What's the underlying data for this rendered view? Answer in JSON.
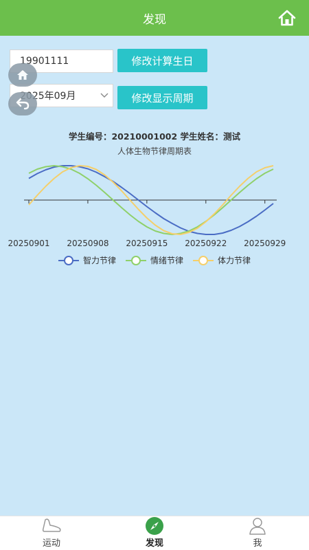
{
  "header": {
    "title": "发现",
    "home_icon": "home-icon"
  },
  "form": {
    "birthday_value": "19901111",
    "month_value": "2025年09月",
    "change_birthday_label": "修改计算生日",
    "change_period_label": "修改显示周期"
  },
  "float_buttons": {
    "home_icon": "home-icon",
    "back_icon": "back-arrow-icon"
  },
  "student": {
    "info": "学生编号：20210001002 学生姓名：测试"
  },
  "chart_title": "人体生物节律周期表",
  "chart_data": {
    "type": "line",
    "title": "人体生物节律周期表",
    "x_tick_labels": [
      "20250901",
      "20250908",
      "20250915",
      "20250922",
      "20250929"
    ],
    "x_range": [
      1,
      30
    ],
    "ylim": [
      -1,
      1
    ],
    "grid": false,
    "legend_position": "bottom",
    "series": [
      {
        "name": "智力节律",
        "color": "#4a6cc4",
        "period_days": 33,
        "values": [
          0.63,
          0.77,
          0.88,
          0.96,
          1.0,
          1.0,
          0.97,
          0.91,
          0.81,
          0.68,
          0.54,
          0.37,
          0.19,
          0.0,
          -0.19,
          -0.37,
          -0.54,
          -0.68,
          -0.81,
          -0.91,
          -0.97,
          -1.0,
          -1.0,
          -0.96,
          -0.88,
          -0.77,
          -0.63,
          -0.47,
          -0.29,
          -0.1
        ]
      },
      {
        "name": "情绪节律",
        "color": "#8fd06a",
        "period_days": 28,
        "values": [
          0.78,
          0.9,
          0.97,
          1.0,
          0.97,
          0.9,
          0.78,
          0.62,
          0.43,
          0.22,
          0.0,
          -0.22,
          -0.43,
          -0.62,
          -0.78,
          -0.9,
          -0.97,
          -1.0,
          -0.97,
          -0.9,
          -0.78,
          -0.62,
          -0.43,
          -0.22,
          0.0,
          0.22,
          0.43,
          0.62,
          0.78,
          0.9
        ]
      },
      {
        "name": "体力节律",
        "color": "#f5cf6a",
        "period_days": 23,
        "values": [
          -0.14,
          0.14,
          0.4,
          0.63,
          0.82,
          0.94,
          1.0,
          0.98,
          0.89,
          0.73,
          0.52,
          0.27,
          0.0,
          -0.27,
          -0.52,
          -0.73,
          -0.89,
          -0.98,
          -1.0,
          -0.94,
          -0.82,
          -0.63,
          -0.4,
          -0.14,
          0.14,
          0.4,
          0.63,
          0.82,
          0.94,
          1.0
        ]
      }
    ]
  },
  "tabs": [
    {
      "label": "运动",
      "icon": "shoe-icon"
    },
    {
      "label": "发现",
      "icon": "compass-icon"
    },
    {
      "label": "我",
      "icon": "user-icon"
    }
  ],
  "colors": {
    "header": "#6cbf4c",
    "button": "#29c4c9",
    "background": "#cbe7f8"
  }
}
